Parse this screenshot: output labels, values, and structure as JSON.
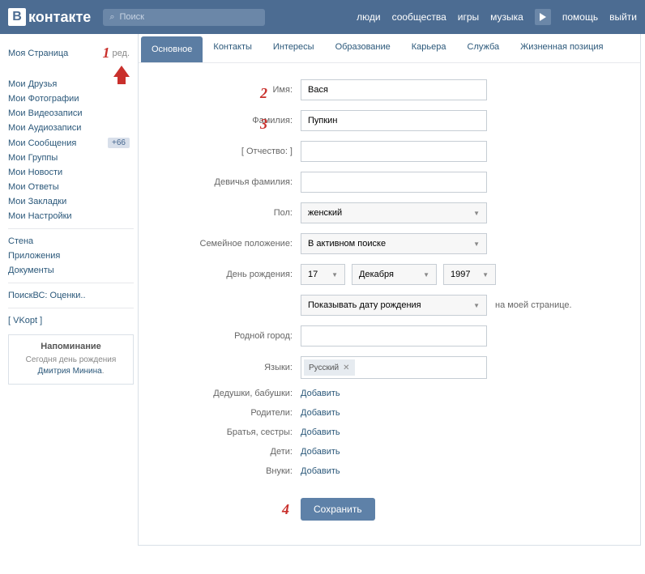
{
  "header": {
    "logo": "контакте",
    "logo_letter": "В",
    "search_placeholder": "Поиск",
    "nav": [
      "люди",
      "сообщества",
      "игры",
      "музыка"
    ],
    "nav_right": [
      "помощь",
      "выйти"
    ]
  },
  "sidebar": {
    "items": [
      {
        "label": "Моя Страница",
        "edit": "ред."
      },
      {
        "label": "Мои Друзья"
      },
      {
        "label": "Мои Фотографии"
      },
      {
        "label": "Мои Видеозаписи"
      },
      {
        "label": "Мои Аудиозаписи"
      },
      {
        "label": "Мои Сообщения",
        "badge": "+66"
      },
      {
        "label": "Мои Группы"
      },
      {
        "label": "Мои Новости"
      },
      {
        "label": "Мои Ответы"
      },
      {
        "label": "Мои Закладки"
      },
      {
        "label": "Мои Настройки"
      }
    ],
    "group2": [
      {
        "label": "Стена"
      },
      {
        "label": "Приложения"
      },
      {
        "label": "Документы"
      }
    ],
    "group3": [
      {
        "label": "ПоискВС: Оценки.."
      }
    ],
    "group4": [
      {
        "label": "[ VKopt ]"
      }
    ],
    "reminder": {
      "title": "Напоминание",
      "text_prefix": "Сегодня ",
      "text_mid": "день рождения ",
      "link": "Дмитрия Минина",
      "text_suffix": "."
    }
  },
  "annotations": {
    "a1": "1",
    "a2": "2",
    "a3": "3",
    "a4": "4"
  },
  "tabs": [
    "Основное",
    "Контакты",
    "Интересы",
    "Образование",
    "Карьера",
    "Служба",
    "Жизненная позиция"
  ],
  "form": {
    "name": {
      "label": "Имя:",
      "value": "Вася"
    },
    "surname": {
      "label": "Фамилия:",
      "value": "Пупкин"
    },
    "patronymic": {
      "label": "[ Отчество: ]",
      "value": ""
    },
    "maiden": {
      "label": "Девичья фамилия:",
      "value": ""
    },
    "sex": {
      "label": "Пол:",
      "value": "женский"
    },
    "marital": {
      "label": "Семейное положение:",
      "value": "В активном поиске"
    },
    "birthday": {
      "label": "День рождения:",
      "day": "17",
      "month": "Декабря",
      "year": "1997"
    },
    "date_visibility": {
      "value": "Показывать дату рождения",
      "hint": "на моей странице."
    },
    "hometown": {
      "label": "Родной город:",
      "value": ""
    },
    "languages": {
      "label": "Языки:",
      "tag": "Русский"
    },
    "relatives": [
      {
        "label": "Дедушки, бабушки:",
        "action": "Добавить"
      },
      {
        "label": "Родители:",
        "action": "Добавить"
      },
      {
        "label": "Братья, сестры:",
        "action": "Добавить"
      },
      {
        "label": "Дети:",
        "action": "Добавить"
      },
      {
        "label": "Внуки:",
        "action": "Добавить"
      }
    ],
    "save": "Сохранить"
  }
}
